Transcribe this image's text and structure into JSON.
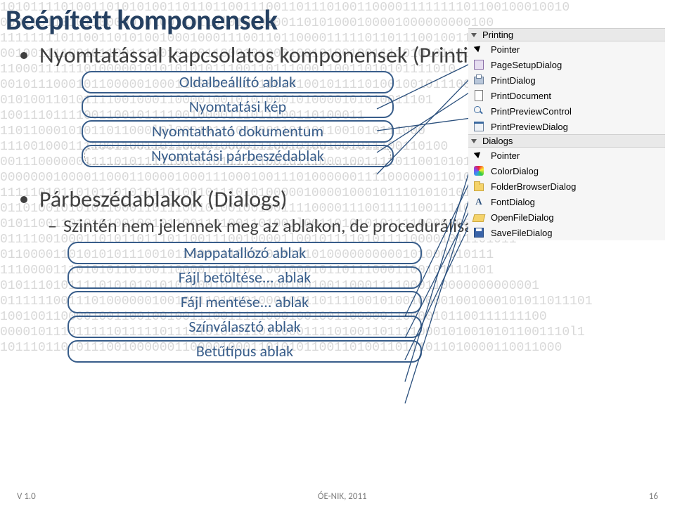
{
  "title": "Beépített komponensek",
  "sections": [
    {
      "heading": "Nyomtatással kapcsolatos komponensek (Printing)",
      "callouts": [
        "Oldalbeállító ablak",
        "Nyomtatási kép",
        "Nyomtatható dokumentum",
        "Nyomtatási párbeszédablak"
      ]
    },
    {
      "heading": "Párbeszédablakok (Dialogs)",
      "sub": "Szintén nem jelennek meg az ablakon, de procedurálisan megjeleníthetők",
      "callouts": [
        "Mappatallózó ablak",
        "Fájl betöltése... ablak",
        "Fájl mentése... ablak",
        "Színválasztó ablak",
        "Betűtípus ablak"
      ]
    }
  ],
  "palette": {
    "groups": [
      {
        "name": "Printing",
        "items": [
          {
            "label": "Pointer",
            "icon": "ic-pointer"
          },
          {
            "label": "PageSetupDialog",
            "icon": "ic-page"
          },
          {
            "label": "PrintDialog",
            "icon": "ic-printer"
          },
          {
            "label": "PrintDocument",
            "icon": "ic-doc"
          },
          {
            "label": "PrintPreviewControl",
            "icon": "ic-magn"
          },
          {
            "label": "PrintPreviewDialog",
            "icon": "ic-dialog"
          }
        ]
      },
      {
        "name": "Dialogs",
        "items": [
          {
            "label": "Pointer",
            "icon": "ic-pointer"
          },
          {
            "label": "ColorDialog",
            "icon": "ic-color"
          },
          {
            "label": "FolderBrowserDialog",
            "icon": "ic-folder"
          },
          {
            "label": "FontDialog",
            "icon": "ic-font"
          },
          {
            "label": "OpenFileDialog",
            "icon": "ic-open"
          },
          {
            "label": "SaveFileDialog",
            "icon": "ic-save"
          }
        ]
      }
    ]
  },
  "footer": {
    "left": "V 1.0",
    "center": "ÓE-NIK, 2011",
    "right": "16"
  },
  "bg_bits": "101011110100110101010011011011001110011011101001100001111111101100100010010\n000110110101100000l0l001l01l0l01010100110101000100001000000000100\n111111110110011010100100010001110011011000011111011011100100110101100\n001001111001011001110010100110001010001001010010011110101011001l001\n110001111110100000101010101011100110111000110011010101111010\n001011100010110000010001100010111011010100101111010010010111000\n010100110101111001000110000100101010001010000101010011101\n100111011110011001011110010000111011100110100011\n11011000101011011000l0l000101110110011011011001010111000\n11100100011110011001101100001000011100101001001011100110100\n0011100000011110101111100001011111100101110001001111011001010111110\n00000001000011000110000100011100010011101000000111100000011010\n111110101101011010101101001011101010000010000100010111010101011110111\n01101001010101100011011100101001001001111000011100111110011110100110110\n010110011010101001001011001101001101001l00110101010111100000001000101\n01111001000110101101110110011100100001l00101111010111100001011101011\n01100001101010101110010110000110101010101010000000000101000010111\n11100001110101011010011000011101011001000101101110001100101111001\n01011101011110101010101010001010110000100100110001111000110000000000001\n011111100111010000001001001101010100010011011110010100100001001000101011011101\n100100110000100110010010011100111110001001001100000110000101100111111100\n000010111011111011111011111010111101100011110100110111100010100101011001110l1\n10111011010111001000000110000100011010101100110100110111011010000110011000"
}
